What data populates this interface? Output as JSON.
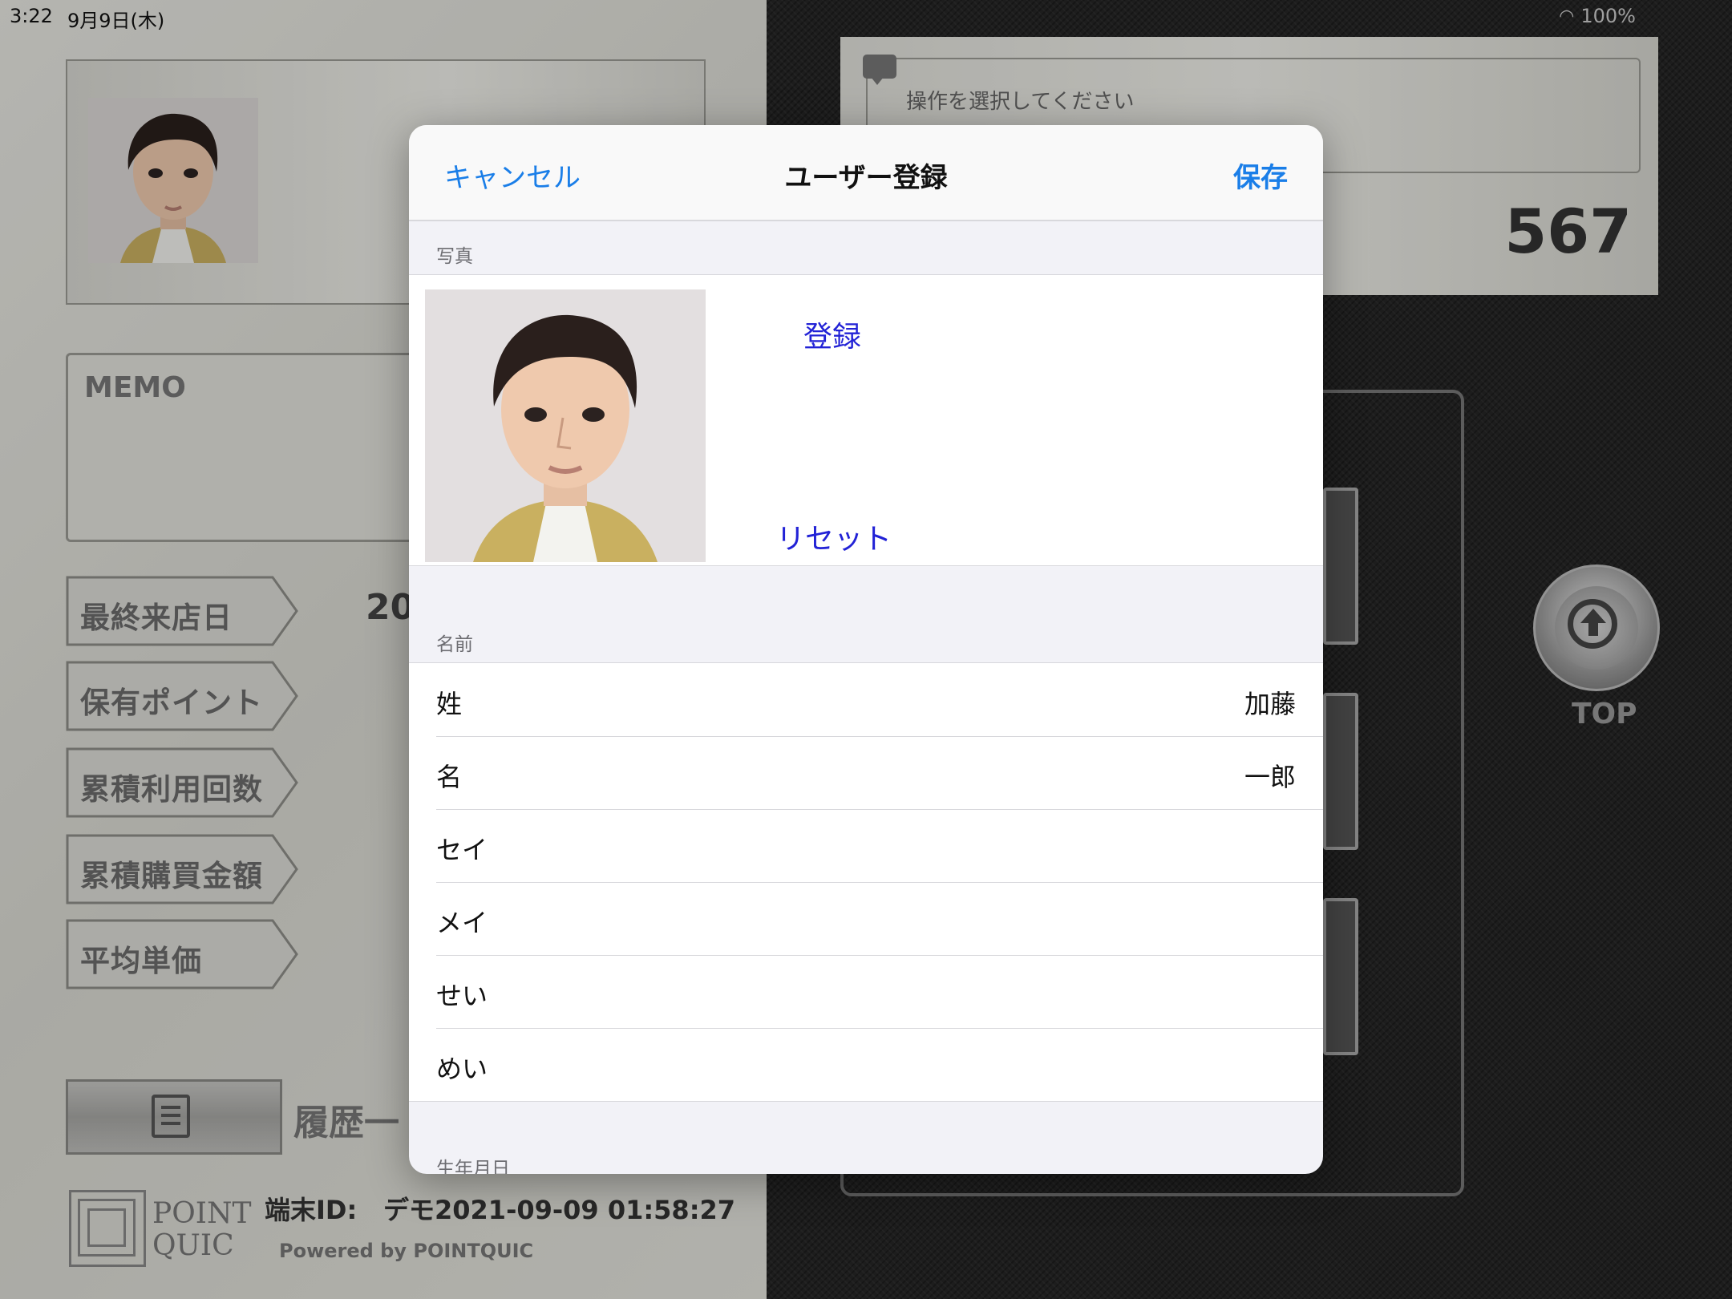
{
  "status_bar": {
    "time": "3:22",
    "date": "9月9日(木)",
    "battery": "100%"
  },
  "left_panel": {
    "memo_label": "MEMO",
    "stats": [
      {
        "label": "最終来店日"
      },
      {
        "label": "保有ポイント"
      },
      {
        "label": "累積利用回数"
      },
      {
        "label": "累積購買金額"
      },
      {
        "label": "平均単価"
      }
    ],
    "last_visit_partial": "20",
    "history_label": "履歴一",
    "logo_text_line1": "POINT",
    "logo_text_line2": "QUIC",
    "terminal_label": "端末ID:",
    "terminal_value": "デモ2021-09-09 01:58:27",
    "powered_by": "Powered by POINTQUIC"
  },
  "right_panel": {
    "message": "操作を選択してください",
    "number": "567",
    "top_label": "TOP"
  },
  "modal": {
    "cancel_label": "キャンセル",
    "title": "ユーザー登録",
    "save_label": "保存",
    "photo_section_label": "写真",
    "register_label": "登録",
    "reset_label": "リセット",
    "name_section_label": "名前",
    "name_rows": [
      {
        "label": "姓",
        "value": "加藤"
      },
      {
        "label": "名",
        "value": "一郎"
      },
      {
        "label": "セイ",
        "value": ""
      },
      {
        "label": "メイ",
        "value": ""
      },
      {
        "label": "せい",
        "value": ""
      },
      {
        "label": "めい",
        "value": ""
      }
    ],
    "birthday_section_label": "生年月日"
  },
  "colors": {
    "accent_blue": "#1a7ee8",
    "link_blue": "#2222d6"
  }
}
